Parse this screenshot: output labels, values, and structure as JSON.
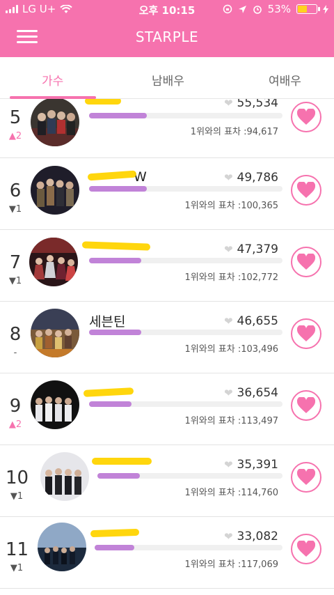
{
  "status_bar": {
    "carrier": "LG U+",
    "time": "오후 10:15",
    "battery": "53%"
  },
  "header": {
    "title": "STARPLE"
  },
  "tabs": [
    {
      "label": "가수",
      "active": true
    },
    {
      "label": "남배우",
      "active": false
    },
    {
      "label": "여배우",
      "active": false
    }
  ],
  "colors": {
    "brand": "#f672ae",
    "bar": "#c183d8",
    "scribble": "#ffd400"
  },
  "items": [
    {
      "rank": "5",
      "change": "▲2",
      "name": "",
      "votes": "55,534",
      "diff_label": "1위와의 표차 :94,617",
      "progress": 0.3
    },
    {
      "rank": "6",
      "change": "▼1",
      "name": "W",
      "votes": "49,786",
      "diff_label": "1위와의 표차 :100,365",
      "progress": 0.3
    },
    {
      "rank": "7",
      "change": "▼1",
      "name": "",
      "votes": "47,379",
      "diff_label": "1위와의 표차 :102,772",
      "progress": 0.27
    },
    {
      "rank": "8",
      "change": "-",
      "name": "세븐틴",
      "votes": "46,655",
      "diff_label": "1위와의 표차 :103,496",
      "progress": 0.27
    },
    {
      "rank": "9",
      "change": "▲2",
      "name": "",
      "votes": "36,654",
      "diff_label": "1위와의 표차 :113,497",
      "progress": 0.22
    },
    {
      "rank": "10",
      "change": "▼1",
      "name": "",
      "votes": "35,391",
      "diff_label": "1위와의 표차 :114,760",
      "progress": 0.23
    },
    {
      "rank": "11",
      "change": "▼1",
      "name": "",
      "votes": "33,082",
      "diff_label": "1위와의 표차 :117,069",
      "progress": 0.21
    }
  ]
}
